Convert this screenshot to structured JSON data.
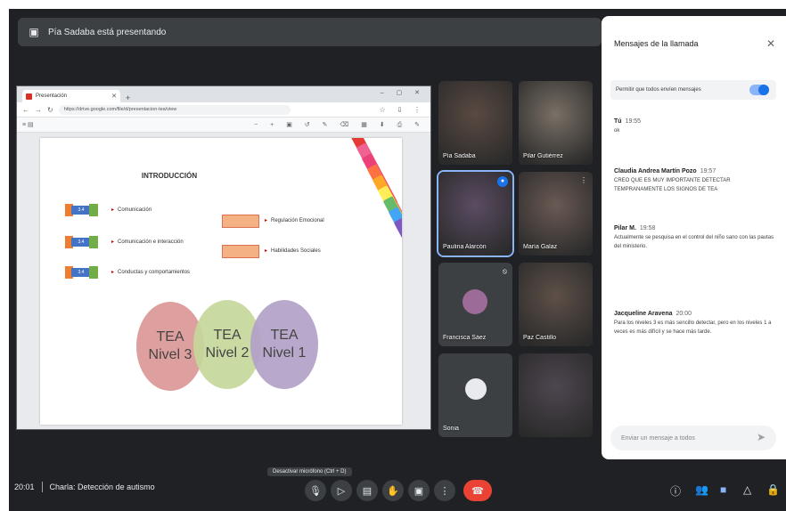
{
  "meeting": {
    "presenter_banner": "Pía Sadaba está presentando",
    "time": "20:01",
    "meeting_name": "Charla: Detección de autismo",
    "tooltip": "Desactivar micrófono (Ctrl + D)"
  },
  "browser": {
    "tab_title": "Presentación",
    "url": "https://drive.google.com/file/d/presentacion-tea/view"
  },
  "slide": {
    "title": "INTRODUCCIÓN",
    "items_left": [
      "Comunicación",
      "Comunicación e interacción",
      "Conductas y comportamientos"
    ],
    "items_right": [
      "Regulación Emocional",
      "Habilidades Sociales"
    ],
    "levels": [
      {
        "line1": "TEA",
        "line2": "Nivel 3"
      },
      {
        "line1": "TEA",
        "line2": "Nivel 2"
      },
      {
        "line1": "TEA",
        "line2": "Nivel 1"
      }
    ],
    "stripe_colors": [
      "#e53935",
      "#f06292",
      "#ec407a",
      "#ff7043",
      "#ffa726",
      "#ffee58",
      "#66bb6a",
      "#42a5f5",
      "#7e57c2"
    ]
  },
  "participants": [
    {
      "name": "Pía Sadaba",
      "tint": "#5a4a42"
    },
    {
      "name": "Pilar Gutiérrez",
      "tint": "#7a7066"
    },
    {
      "name": "Paulina Alarcón",
      "tint": "#5b4c63"
    },
    {
      "name": "María Galaz",
      "tint": "#6a5a54"
    },
    {
      "name": "Francisca Sáez",
      "tint": ""
    },
    {
      "name": "Paz Castillo",
      "tint": "#5e5048"
    },
    {
      "name": "Sonia",
      "tint": ""
    },
    {
      "name": "",
      "tint": "#4e4650"
    }
  ],
  "chat": {
    "header": "Mensajes de la llamada",
    "toggle_label": "Permitir que todos envíen mensajes",
    "messages": [
      {
        "sender": "Tú",
        "time": "19:55",
        "text": "ok"
      },
      {
        "sender": "Claudia Andrea Martín Pozo",
        "time": "19:57",
        "text": "CREO QUE ES MUY IMPORTANTE DETECTAR TEMPRANAMENTE LOS SIGNOS DE TEA"
      },
      {
        "sender": "Pilar M.",
        "time": "19:58",
        "text": "Actualmente se pesquisa en el control del niño sano con las pautas del ministerio."
      },
      {
        "sender": "Jacqueline Aravena",
        "time": "20:00",
        "text": "Para los niveles 3 es más sencillo detectar, pero en los niveles 1 a veces es más difícil y se hace más tarde."
      }
    ],
    "input_placeholder": "Enviar un mensaje a todos"
  },
  "icons": {
    "presenting": "present-icon",
    "close": "close-icon",
    "send": "send-icon",
    "mic": "mic-icon",
    "camera": "camera-icon",
    "captions": "captions-icon",
    "hand": "raise-hand-icon",
    "present_screen": "present-screen-icon",
    "more": "more-options-icon",
    "end_call": "end-call-icon",
    "info": "info-icon",
    "people": "people-icon",
    "chat": "chat-icon",
    "activities": "activities-icon",
    "lock": "host-controls-icon"
  },
  "colors": {
    "meet_bg": "#202124",
    "end_call": "#ea4335",
    "accent": "#1a73e8"
  }
}
